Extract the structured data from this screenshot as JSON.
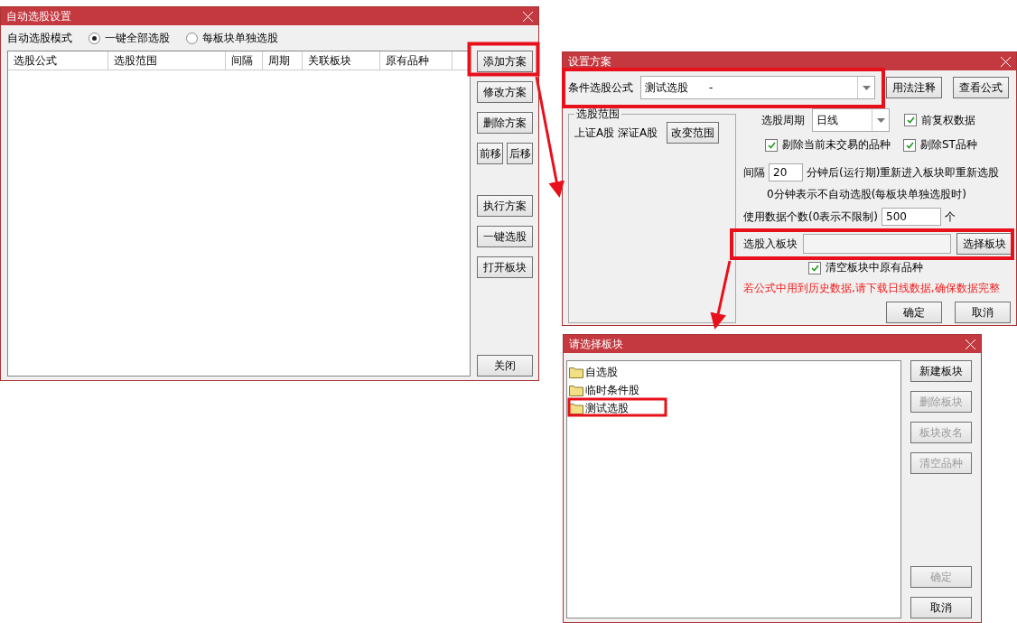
{
  "main_dialog": {
    "title": "自动选股设置",
    "mode_label": "自动选股模式",
    "mode_options": [
      {
        "label": "一键全部选股",
        "selected": true
      },
      {
        "label": "每板块单独选股",
        "selected": false
      }
    ],
    "table": {
      "columns": [
        "选股公式",
        "选股范围",
        "间隔",
        "周期",
        "关联板块",
        "原有品种"
      ]
    },
    "button_rows": [
      [
        "添加方案"
      ],
      [
        "修改方案"
      ],
      [
        "删除方案"
      ],
      [
        "前移",
        "后移"
      ]
    ],
    "action_buttons": [
      "执行方案",
      "一键选股",
      "打开板块"
    ],
    "close_button": "关闭"
  },
  "scheme_dialog": {
    "title": "设置方案",
    "formula_label": "条件选股公式",
    "formula_value": "测试选股      -",
    "top_buttons": [
      "用法注释",
      "查看公式"
    ],
    "range_group": {
      "legend": "选股范围",
      "markets": "上证A股 深证A股",
      "button": "改变范围"
    },
    "period_label": "选股周期",
    "period_value": "日线",
    "checkboxes": [
      {
        "label": "前复权数据",
        "checked": true
      },
      {
        "label": "剔除当前未交易的品种",
        "checked": true
      },
      {
        "label": "剔除ST品种",
        "checked": true
      }
    ],
    "interval_label": "间隔",
    "interval_value": "20",
    "interval_suffix": "分钟后(运行期)重新进入板块即重新选股",
    "interval_note": "0分钟表示不自动选股(每板块单独选股时)",
    "count_label": "使用数据个数(0表示不限制)",
    "count_value": "500",
    "count_unit": "个",
    "target_label": "选股入板块",
    "target_button": "选择板块",
    "clear_checkbox": {
      "label": "清空板块中原有品种",
      "checked": true
    },
    "warning": "若公式中用到历史数据,请下载日线数据,确保数据完整",
    "ok_button": "确定",
    "cancel_button": "取消"
  },
  "block_dialog": {
    "title": "请选择板块",
    "items": [
      "自选股",
      "临时条件股",
      "测试选股"
    ],
    "buttons": [
      {
        "label": "新建板块",
        "disabled": false
      },
      {
        "label": "删除板块",
        "disabled": true
      },
      {
        "label": "板块改名",
        "disabled": true
      },
      {
        "label": "清空品种",
        "disabled": true
      }
    ],
    "bottom_buttons": [
      {
        "label": "确定",
        "disabled": true
      },
      {
        "label": "取消",
        "disabled": false
      }
    ]
  }
}
